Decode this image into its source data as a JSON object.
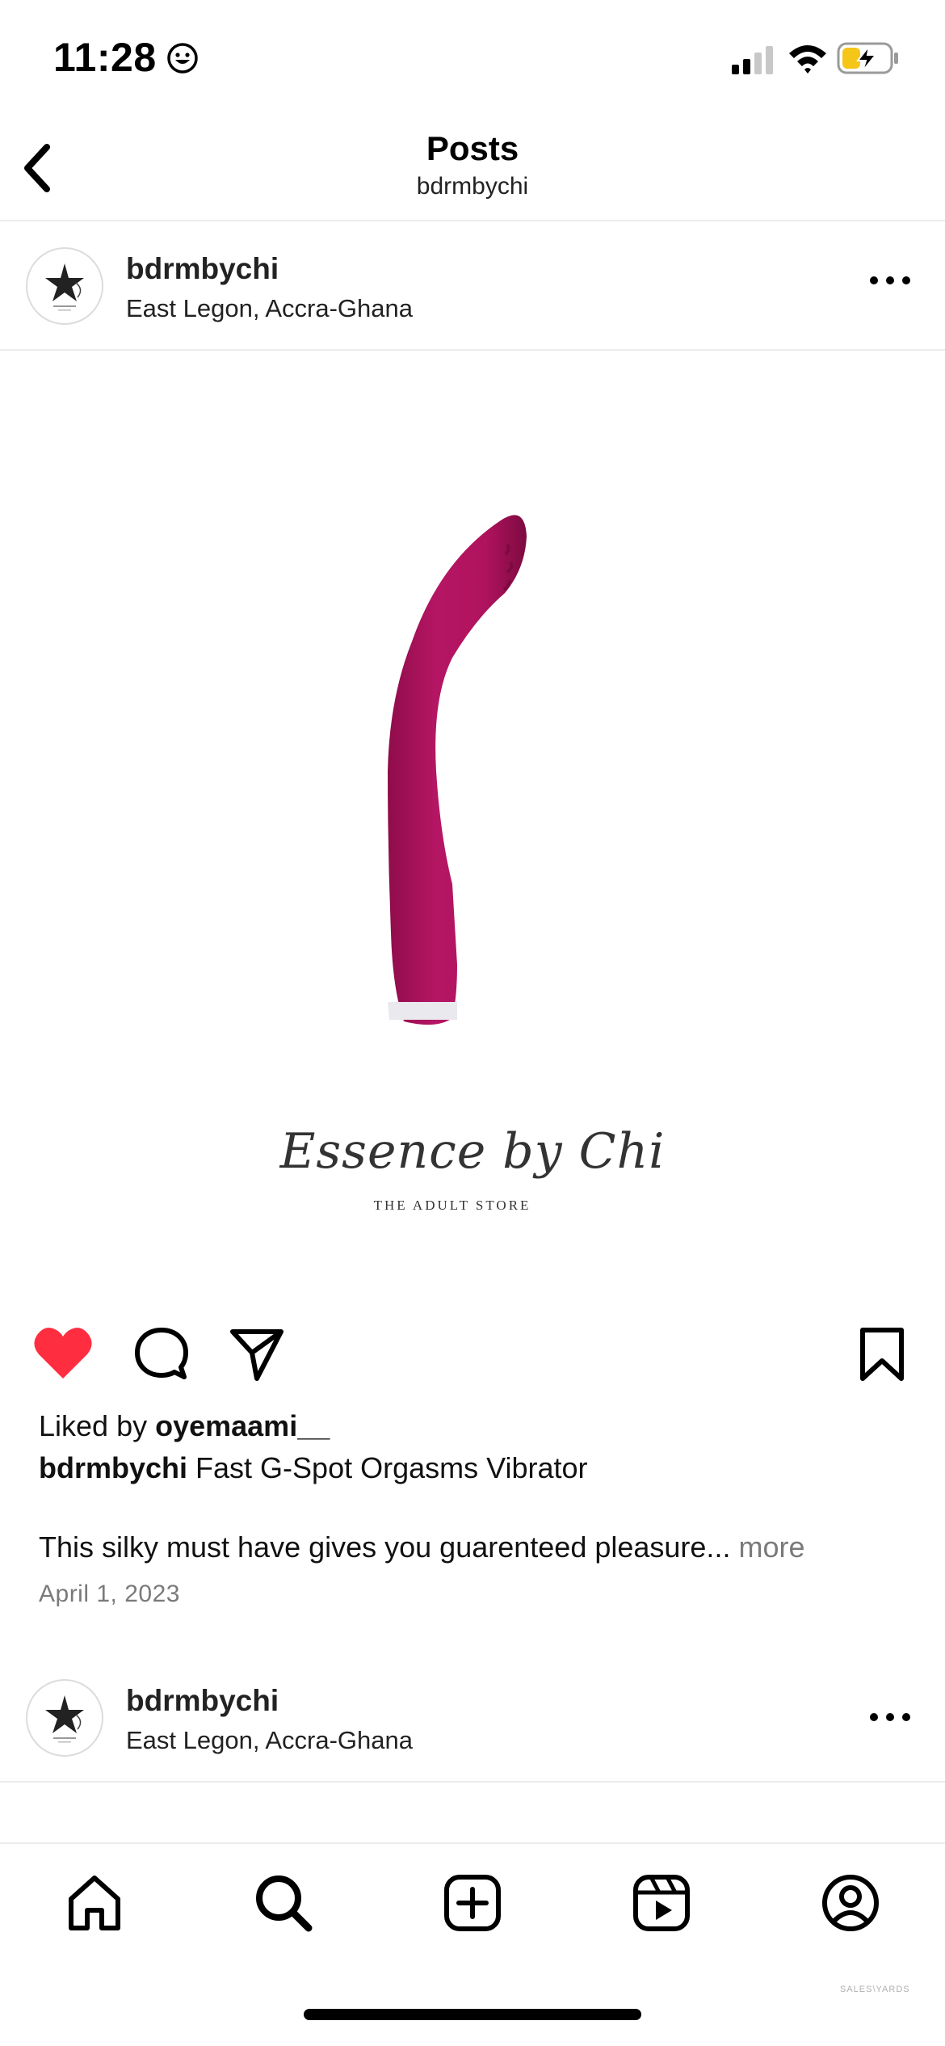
{
  "status_bar": {
    "time": "11:28",
    "emoji_icon": "grinning-face-icon",
    "signal_icon": "cellular-signal-icon",
    "wifi_icon": "wifi-icon",
    "battery_icon": "battery-charging-icon",
    "battery_color": "#F5C518"
  },
  "header": {
    "title": "Posts",
    "subtitle": "bdrmbychi",
    "back_icon": "chevron-left-icon"
  },
  "posts": [
    {
      "username": "bdrmbychi",
      "location": "East Legon, Accra-Ghana",
      "more_icon": "ellipsis-icon",
      "image": {
        "product_color": "#B0135E",
        "brand_script": "Essence by Chi",
        "brand_sub": "THE ADULT STORE"
      },
      "actions": {
        "liked": true,
        "like_color": "#FF2D40",
        "icons": [
          "heart-icon",
          "comment-icon",
          "share-icon",
          "bookmark-icon"
        ]
      },
      "liked_by_prefix": "Liked by ",
      "liked_by_user": "oyemaami__",
      "caption_user": "bdrmbychi",
      "caption_text": " Fast G-Spot Orgasms Vibrator",
      "caption_extra": "This silky must have gives you guarenteed pleasure... ",
      "more_label": "more",
      "date": "April 1, 2023"
    },
    {
      "username": "bdrmbychi",
      "location": "East Legon, Accra-Ghana",
      "more_icon": "ellipsis-icon"
    }
  ],
  "tab_bar": {
    "items": [
      "home-icon",
      "search-icon",
      "create-post-icon",
      "reels-icon",
      "profile-icon"
    ]
  },
  "watermark": "SALES\\YARDS"
}
